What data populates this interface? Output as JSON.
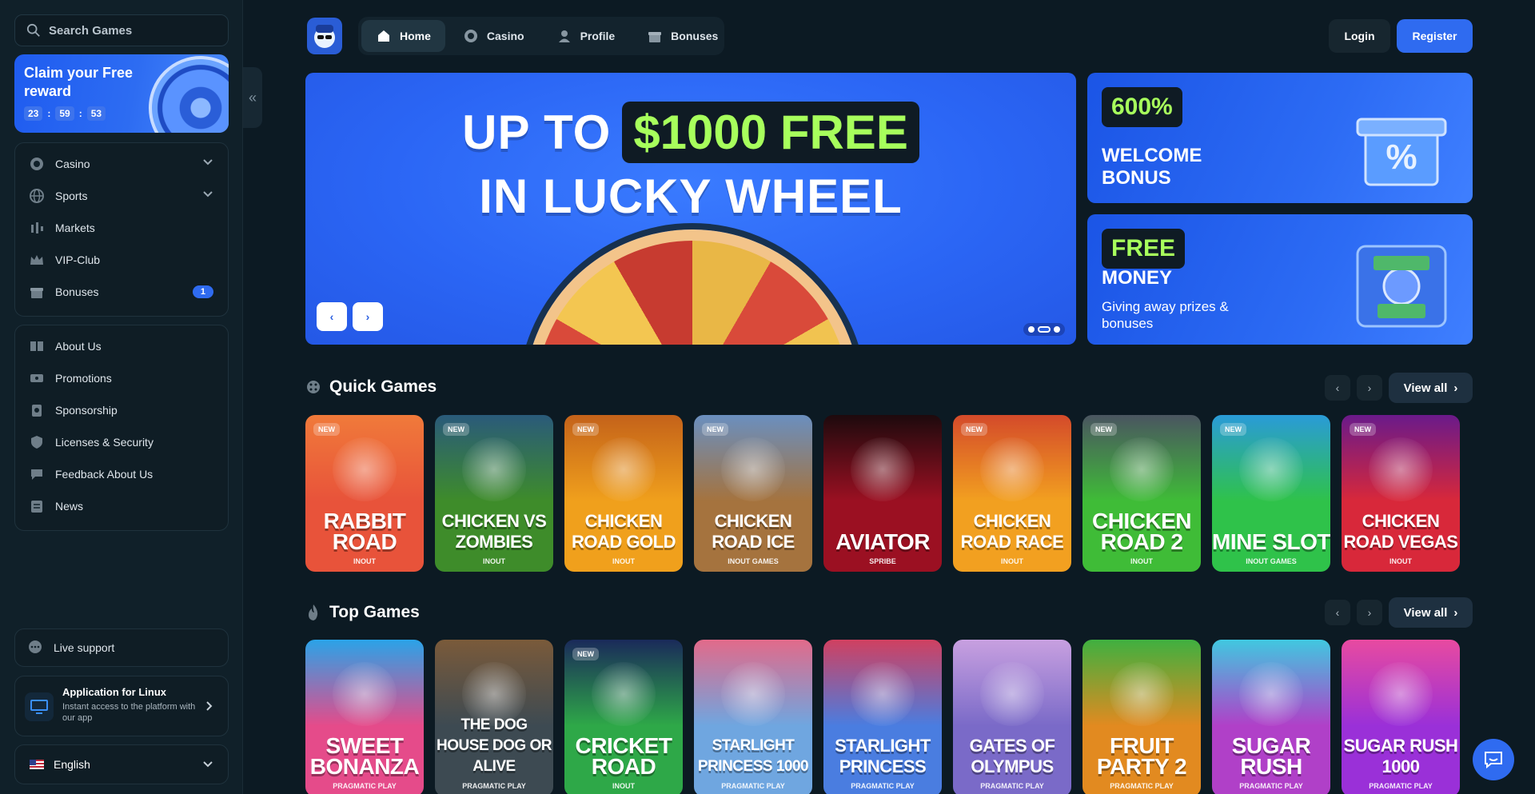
{
  "sidebar": {
    "search_placeholder": "Search Games",
    "claim": {
      "title": "Claim your Free reward",
      "timer": [
        "23",
        "59",
        "53"
      ]
    },
    "nav_main": [
      {
        "label": "Casino",
        "icon": "casino-icon",
        "has_chevron": true
      },
      {
        "label": "Sports",
        "icon": "globe-icon",
        "has_chevron": true
      },
      {
        "label": "Markets",
        "icon": "markets-icon"
      },
      {
        "label": "VIP-Club",
        "icon": "crown-icon"
      },
      {
        "label": "Bonuses",
        "icon": "gift-icon",
        "badge": "1"
      }
    ],
    "nav_info": [
      {
        "label": "About Us",
        "icon": "book-icon"
      },
      {
        "label": "Promotions",
        "icon": "ticket-icon"
      },
      {
        "label": "Sponsorship",
        "icon": "sponsor-icon"
      },
      {
        "label": "Licenses & Security",
        "icon": "shield-icon"
      },
      {
        "label": "Feedback About Us",
        "icon": "feedback-icon"
      },
      {
        "label": "News",
        "icon": "news-icon"
      }
    ],
    "support_label": "Live support",
    "app": {
      "title": "Application for Linux",
      "subtitle": "Instant access to the platform with our app"
    },
    "language": "English"
  },
  "topbar": {
    "tabs": [
      {
        "label": "Home",
        "icon": "home-icon",
        "active": true
      },
      {
        "label": "Casino",
        "icon": "casino-icon"
      },
      {
        "label": "Profile",
        "icon": "user-icon"
      },
      {
        "label": "Bonuses",
        "icon": "gift-icon"
      }
    ],
    "login_label": "Login",
    "register_label": "Register"
  },
  "hero": {
    "line1": "UP TO",
    "amount": "$1000 FREE",
    "line2": "IN LUCKY WHEEL",
    "slide_count": 3,
    "active_slide": 2
  },
  "promos": [
    {
      "pill": "600%",
      "heading": "WELCOME BONUS",
      "sub": ""
    },
    {
      "pill": "FREE",
      "heading": "MONEY",
      "sub": "Giving away prizes & bonuses"
    }
  ],
  "sections": {
    "quick": {
      "title": "Quick Games",
      "view_all": "View all",
      "games": [
        {
          "name": "RABBIT ROAD",
          "provider": "INOUT",
          "new": true,
          "color": "#e8533a",
          "color2": "#f07a3a"
        },
        {
          "name": "CHICKEN VS ZOMBIES",
          "provider": "INOUT",
          "new": true,
          "color": "#3e8c2a",
          "color2": "#2a5a7a"
        },
        {
          "name": "CHICKEN ROAD GOLD",
          "provider": "INOUT",
          "new": true,
          "color": "#f0a01c",
          "color2": "#c4621a"
        },
        {
          "name": "CHICKEN ROAD ICE",
          "provider": "INOUT GAMES",
          "new": true,
          "color": "#a5733e",
          "color2": "#6a8fbf"
        },
        {
          "name": "AVIATOR",
          "provider": "SPRIBE",
          "new": false,
          "color": "#9b1022",
          "color2": "#1d0a0d"
        },
        {
          "name": "CHICKEN ROAD RACE",
          "provider": "INOUT",
          "new": true,
          "color": "#f2a020",
          "color2": "#d44a2a"
        },
        {
          "name": "CHICKEN ROAD 2",
          "provider": "INOUT",
          "new": true,
          "color": "#3fbc37",
          "color2": "#4a5560"
        },
        {
          "name": "MINE SLOT",
          "provider": "INOUT GAMES",
          "new": true,
          "color": "#2fc24a",
          "color2": "#2a9bd8"
        },
        {
          "name": "CHICKEN ROAD VEGAS",
          "provider": "INOUT",
          "new": true,
          "color": "#d8283a",
          "color2": "#6a1a8a"
        }
      ]
    },
    "top": {
      "title": "Top Games",
      "view_all": "View all",
      "games": [
        {
          "name": "SWEET BONANZA",
          "provider": "PRAGMATIC PLAY",
          "new": false,
          "color": "#e54b8a",
          "color2": "#2aa3e8"
        },
        {
          "name": "THE DOG HOUSE DOG OR ALIVE",
          "provider": "PRAGMATIC PLAY",
          "new": false,
          "color": "#3d4a52",
          "color2": "#7a5a3a"
        },
        {
          "name": "CRICKET ROAD",
          "provider": "INOUT",
          "new": true,
          "color": "#2ea848",
          "color2": "#1a2a5a"
        },
        {
          "name": "STARLIGHT PRINCESS 1000",
          "provider": "PRAGMATIC PLAY",
          "new": false,
          "color": "#6fa6e0",
          "color2": "#e26a8a"
        },
        {
          "name": "STARLIGHT PRINCESS",
          "provider": "PRAGMATIC PLAY",
          "new": false,
          "color": "#4a7de0",
          "color2": "#d04060"
        },
        {
          "name": "GATES OF OLYMPUS",
          "provider": "PRAGMATIC PLAY",
          "new": false,
          "color": "#7a6ac8",
          "color2": "#c8a0e0"
        },
        {
          "name": "FRUIT PARTY 2",
          "provider": "PRAGMATIC PLAY",
          "new": false,
          "color": "#e28a20",
          "color2": "#3fb040"
        },
        {
          "name": "SUGAR RUSH",
          "provider": "PRAGMATIC PLAY",
          "new": false,
          "color": "#b040c8",
          "color2": "#40c8e0"
        },
        {
          "name": "SUGAR RUSH 1000",
          "provider": "PRAGMATIC PLAY",
          "new": false,
          "color": "#9a30d8",
          "color2": "#e84aa0"
        }
      ]
    }
  },
  "colors": {
    "accent": "#2f6bf0",
    "highlight": "#a7ff5c",
    "background": "#0c1a23"
  }
}
